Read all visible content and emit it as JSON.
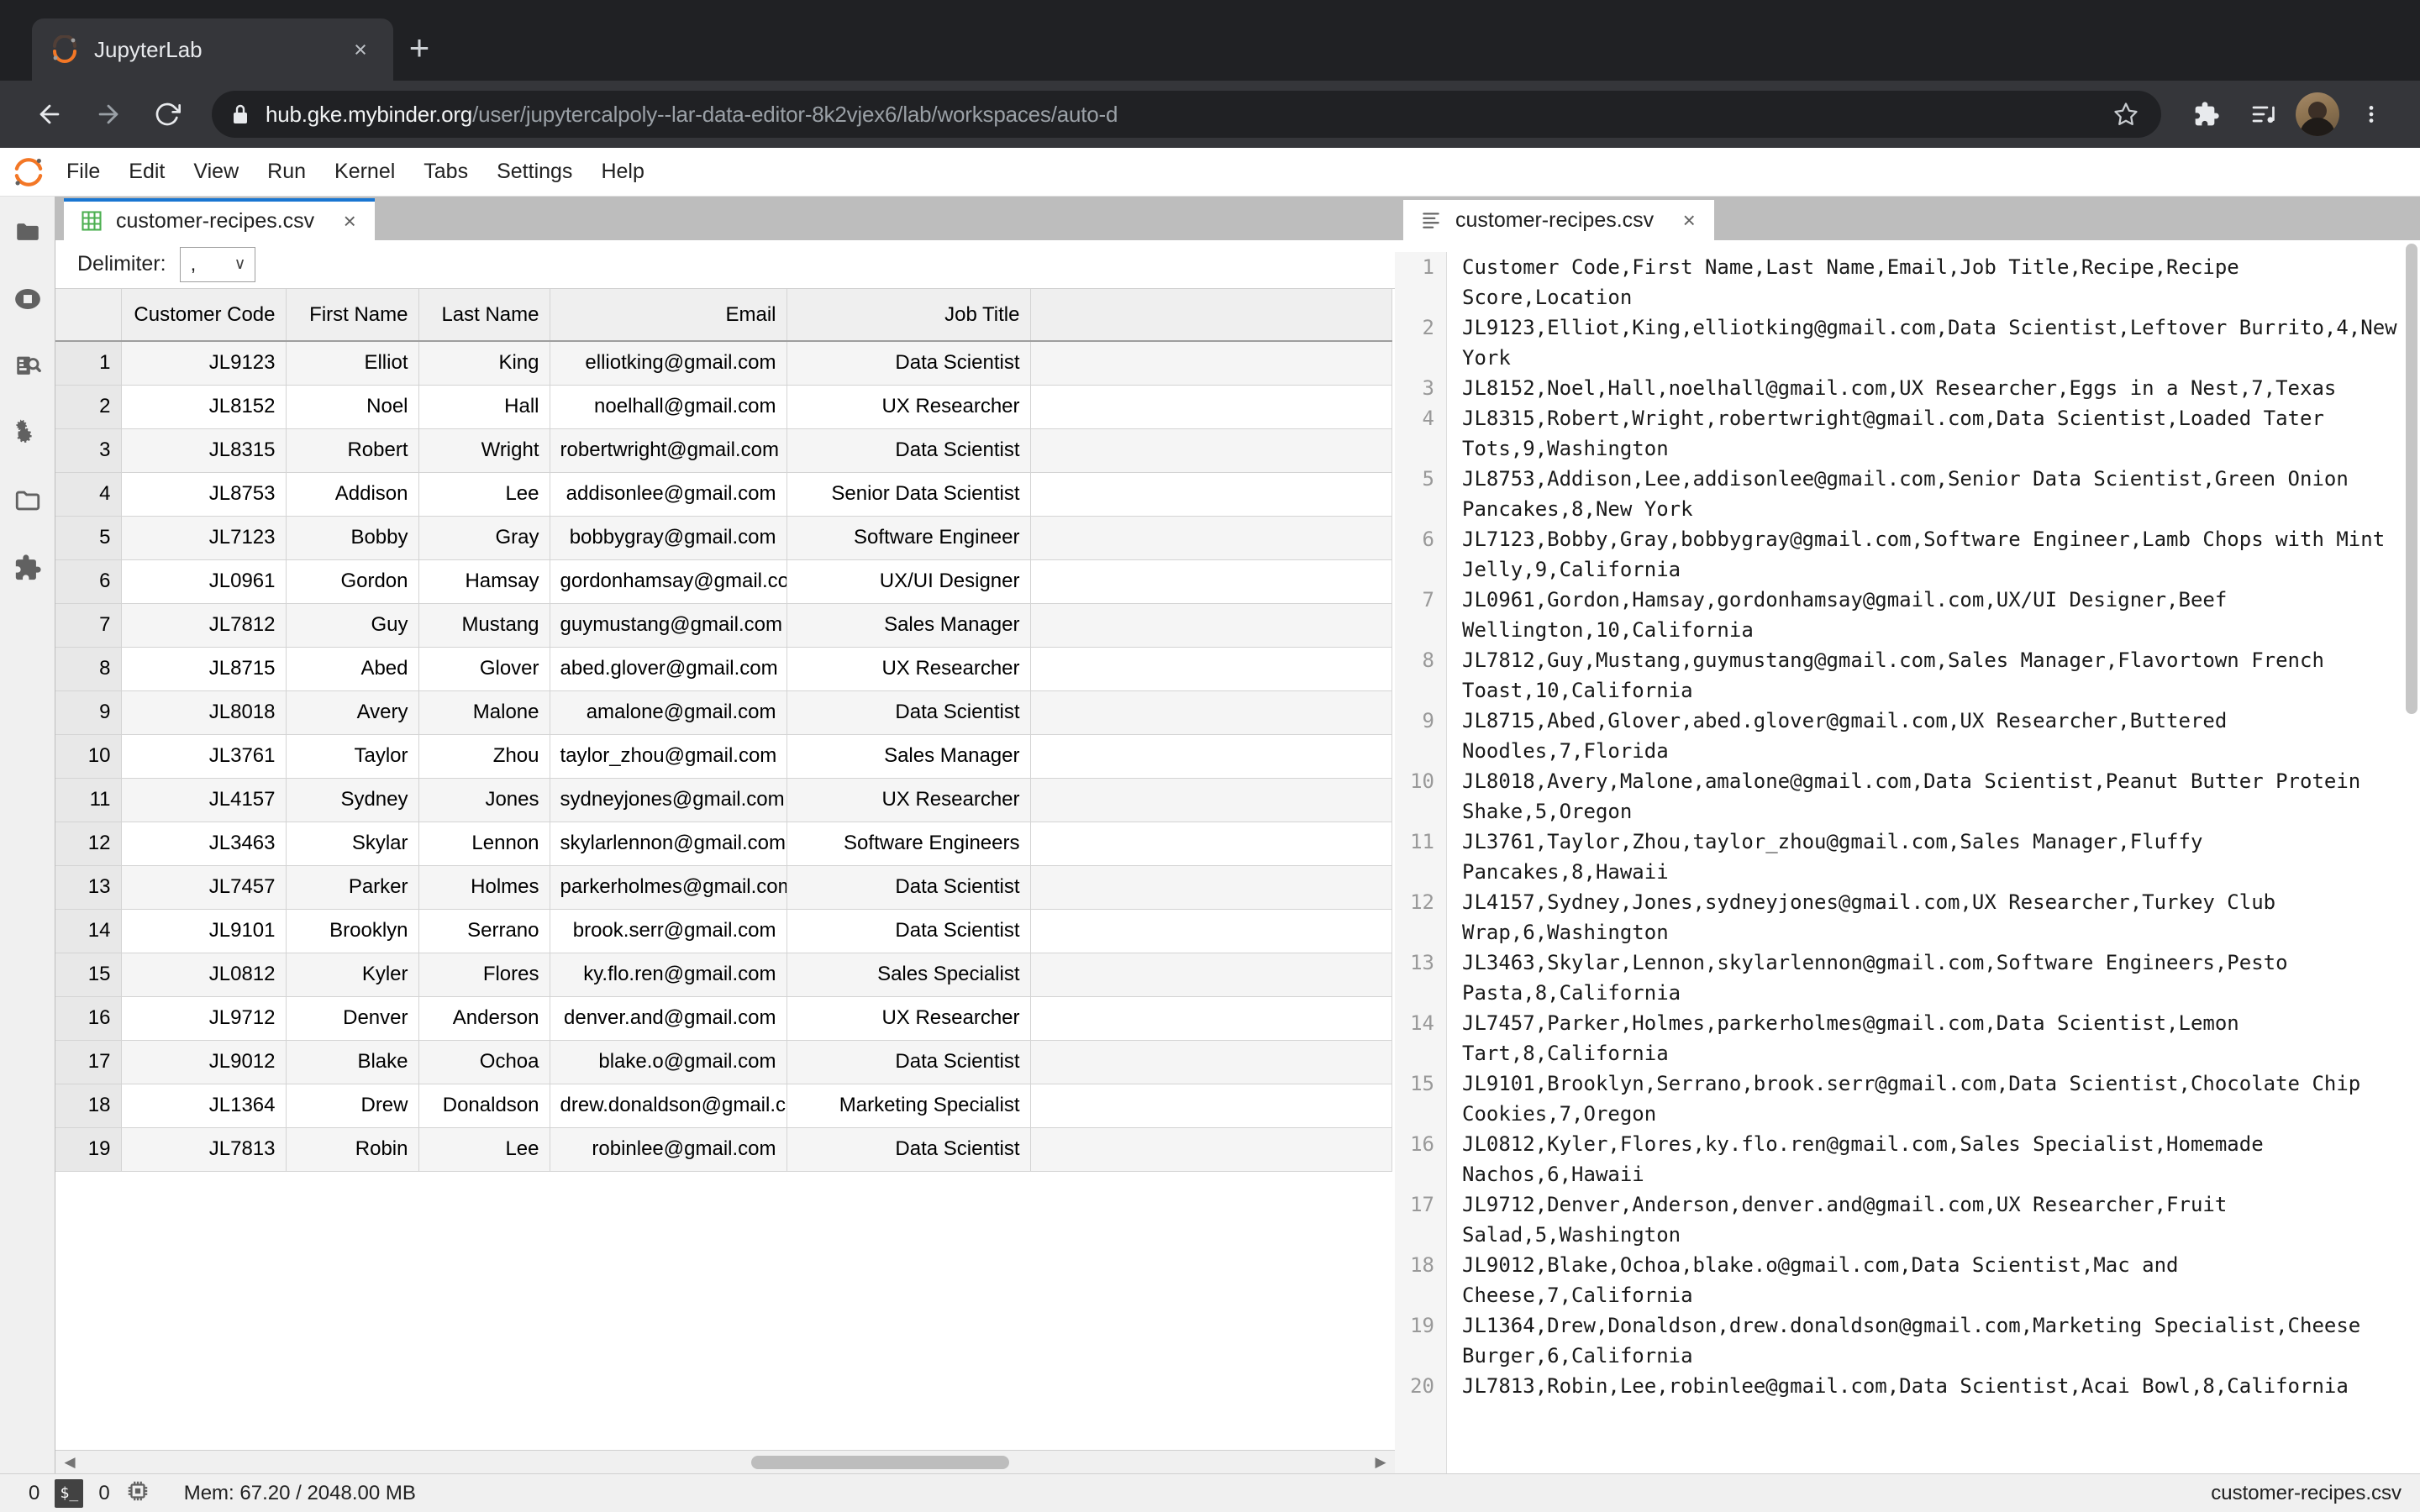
{
  "browser": {
    "tab": {
      "title": "JupyterLab",
      "favicon": "jupyter-logo-icon",
      "close_label": "×"
    },
    "new_tab_label": "+",
    "nav": {
      "back_icon": "back-arrow-icon",
      "forward_icon": "forward-arrow-icon",
      "reload_icon": "reload-icon",
      "lock_icon": "lock-icon"
    },
    "url": {
      "host": "hub.gke.mybinder.org",
      "path": "/user/jupytercalpoly--lar-data-editor-8k2vjex6/lab/workspaces/auto-d"
    },
    "toolbar_icons": [
      "bookmark-star-icon",
      "extensions-puzzle-icon",
      "reading-list-icon",
      "profile-avatar",
      "chrome-menu-icon"
    ]
  },
  "jupyter": {
    "logo": "jupyter-logo-icon",
    "menus": [
      "File",
      "Edit",
      "View",
      "Run",
      "Kernel",
      "Tabs",
      "Settings",
      "Help"
    ],
    "sidebar": [
      {
        "name": "file-browser",
        "icon": "folder-icon"
      },
      {
        "name": "running-terminals-kernels",
        "icon": "stop-circle-icon"
      },
      {
        "name": "table-of-contents",
        "icon": "document-search-icon"
      },
      {
        "name": "property-inspector",
        "icon": "gears-icon"
      },
      {
        "name": "open-tabs",
        "icon": "open-folder-icon"
      },
      {
        "name": "extension-manager",
        "icon": "puzzle-icon"
      }
    ],
    "left_panel": {
      "tab": {
        "label": "customer-recipes.csv",
        "icon": "spreadsheet-grid-icon",
        "close_label": "×"
      },
      "toolbar": {
        "delimiter_label": "Delimiter:",
        "delimiter_value": ",",
        "caret": "∨"
      },
      "grid": {
        "columns": [
          "Customer Code",
          "First Name",
          "Last Name",
          "Email",
          "Job Title"
        ],
        "rows": [
          {
            "n": "1",
            "cells": [
              "JL9123",
              "Elliot",
              "King",
              "elliotking@gmail.com",
              "Data Scientist"
            ]
          },
          {
            "n": "2",
            "cells": [
              "JL8152",
              "Noel",
              "Hall",
              "noelhall@gmail.com",
              "UX Researcher"
            ]
          },
          {
            "n": "3",
            "cells": [
              "JL8315",
              "Robert",
              "Wright",
              "robertwright@gmail.com",
              "Data Scientist"
            ]
          },
          {
            "n": "4",
            "cells": [
              "JL8753",
              "Addison",
              "Lee",
              "addisonlee@gmail.com",
              "Senior Data Scientist"
            ]
          },
          {
            "n": "5",
            "cells": [
              "JL7123",
              "Bobby",
              "Gray",
              "bobbygray@gmail.com",
              "Software Engineer"
            ]
          },
          {
            "n": "6",
            "cells": [
              "JL0961",
              "Gordon",
              "Hamsay",
              "gordonhamsay@gmail.com",
              "UX/UI Designer"
            ]
          },
          {
            "n": "7",
            "cells": [
              "JL7812",
              "Guy",
              "Mustang",
              "guymustang@gmail.com",
              "Sales Manager"
            ]
          },
          {
            "n": "8",
            "cells": [
              "JL8715",
              "Abed",
              "Glover",
              "abed.glover@gmail.com",
              "UX Researcher"
            ]
          },
          {
            "n": "9",
            "cells": [
              "JL8018",
              "Avery",
              "Malone",
              "amalone@gmail.com",
              "Data Scientist"
            ]
          },
          {
            "n": "10",
            "cells": [
              "JL3761",
              "Taylor",
              "Zhou",
              "taylor_zhou@gmail.com",
              "Sales Manager"
            ]
          },
          {
            "n": "11",
            "cells": [
              "JL4157",
              "Sydney",
              "Jones",
              "sydneyjones@gmail.com",
              "UX Researcher"
            ]
          },
          {
            "n": "12",
            "cells": [
              "JL3463",
              "Skylar",
              "Lennon",
              "skylarlennon@gmail.com",
              "Software Engineers"
            ]
          },
          {
            "n": "13",
            "cells": [
              "JL7457",
              "Parker",
              "Holmes",
              "parkerholmes@gmail.com",
              "Data Scientist"
            ]
          },
          {
            "n": "14",
            "cells": [
              "JL9101",
              "Brooklyn",
              "Serrano",
              "brook.serr@gmail.com",
              "Data Scientist"
            ]
          },
          {
            "n": "15",
            "cells": [
              "JL0812",
              "Kyler",
              "Flores",
              "ky.flo.ren@gmail.com",
              "Sales Specialist"
            ]
          },
          {
            "n": "16",
            "cells": [
              "JL9712",
              "Denver",
              "Anderson",
              "denver.and@gmail.com",
              "UX Researcher"
            ]
          },
          {
            "n": "17",
            "cells": [
              "JL9012",
              "Blake",
              "Ochoa",
              "blake.o@gmail.com",
              "Data Scientist"
            ]
          },
          {
            "n": "18",
            "cells": [
              "JL1364",
              "Drew",
              "Donaldson",
              "drew.donaldson@gmail.com",
              "Marketing Specialist"
            ]
          },
          {
            "n": "19",
            "cells": [
              "JL7813",
              "Robin",
              "Lee",
              "robinlee@gmail.com",
              "Data Scientist"
            ]
          }
        ]
      }
    },
    "right_panel": {
      "tab": {
        "label": "customer-recipes.csv",
        "icon": "text-file-icon",
        "close_label": "×"
      },
      "editor": {
        "lines": [
          {
            "n": "1",
            "text": "Customer Code,First Name,Last Name,Email,Job Title,Recipe,Recipe Score,Location"
          },
          {
            "n": "2",
            "text": "JL9123,Elliot,King,elliotking@gmail.com,Data Scientist,Leftover Burrito,4,New York"
          },
          {
            "n": "3",
            "text": "JL8152,Noel,Hall,noelhall@gmail.com,UX Researcher,Eggs in a Nest,7,Texas"
          },
          {
            "n": "4",
            "text": "JL8315,Robert,Wright,robertwright@gmail.com,Data Scientist,Loaded Tater Tots,9,Washington"
          },
          {
            "n": "5",
            "text": "JL8753,Addison,Lee,addisonlee@gmail.com,Senior Data Scientist,Green Onion Pancakes,8,New York"
          },
          {
            "n": "6",
            "text": "JL7123,Bobby,Gray,bobbygray@gmail.com,Software Engineer,Lamb Chops with Mint Jelly,9,California"
          },
          {
            "n": "7",
            "text": "JL0961,Gordon,Hamsay,gordonhamsay@gmail.com,UX/UI Designer,Beef Wellington,10,California"
          },
          {
            "n": "8",
            "text": "JL7812,Guy,Mustang,guymustang@gmail.com,Sales Manager,Flavortown French Toast,10,California"
          },
          {
            "n": "9",
            "text": "JL8715,Abed,Glover,abed.glover@gmail.com,UX Researcher,Buttered Noodles,7,Florida"
          },
          {
            "n": "10",
            "text": "JL8018,Avery,Malone,amalone@gmail.com,Data Scientist,Peanut Butter Protein Shake,5,Oregon"
          },
          {
            "n": "11",
            "text": "JL3761,Taylor,Zhou,taylor_zhou@gmail.com,Sales Manager,Fluffy Pancakes,8,Hawaii"
          },
          {
            "n": "12",
            "text": "JL4157,Sydney,Jones,sydneyjones@gmail.com,UX Researcher,Turkey Club Wrap,6,Washington"
          },
          {
            "n": "13",
            "text": "JL3463,Skylar,Lennon,skylarlennon@gmail.com,Software Engineers,Pesto Pasta,8,California"
          },
          {
            "n": "14",
            "text": "JL7457,Parker,Holmes,parkerholmes@gmail.com,Data Scientist,Lemon Tart,8,California"
          },
          {
            "n": "15",
            "text": "JL9101,Brooklyn,Serrano,brook.serr@gmail.com,Data Scientist,Chocolate Chip Cookies,7,Oregon"
          },
          {
            "n": "16",
            "text": "JL0812,Kyler,Flores,ky.flo.ren@gmail.com,Sales Specialist,Homemade Nachos,6,Hawaii"
          },
          {
            "n": "17",
            "text": "JL9712,Denver,Anderson,denver.and@gmail.com,UX Researcher,Fruit Salad,5,Washington"
          },
          {
            "n": "18",
            "text": "JL9012,Blake,Ochoa,blake.o@gmail.com,Data Scientist,Mac and Cheese,7,California"
          },
          {
            "n": "19",
            "text": "JL1364,Drew,Donaldson,drew.donaldson@gmail.com,Marketing Specialist,Cheese Burger,6,California"
          },
          {
            "n": "20",
            "text": "JL7813,Robin,Lee,robinlee@gmail.com,Data Scientist,Acai Bowl,8,California"
          }
        ]
      }
    },
    "statusbar": {
      "terminals_count": "0",
      "terminal_icon": "terminal-icon",
      "kernels_count": "0",
      "kernel_icon": "cpu-chip-icon",
      "memory": "Mem: 67.20 / 2048.00 MB",
      "current_file": "customer-recipes.csv"
    }
  }
}
